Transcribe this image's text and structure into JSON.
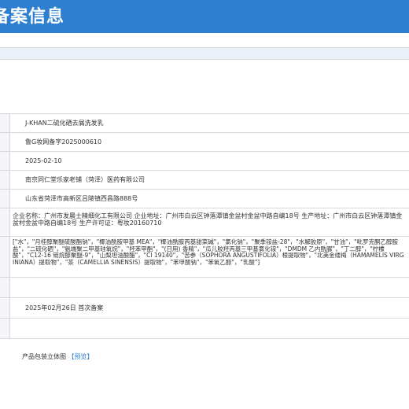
{
  "header": {
    "title": "备案信息"
  },
  "record": {
    "product_name": "J-KHAN二硫化硒去屑洗发乳",
    "record_number": "鲁G妆网备字2025000610",
    "record_date": "2025-02-10",
    "registrant": "南京同仁堂乐家老铺（菏泽）医药有限公司",
    "address": "山东省菏泽市高新区吕陵镇西昌路888号",
    "manufacturer": "企业名称：广州市发晨士精细化工有限公司 企业地址：广州市白云区钟落潭镇金盆村金盆中路自编18号 生产地址：广州市白云区钟落潭镇金盆村金盆中路自编18号 生产许可证：粤妆20160710",
    "ingredients": "[\"水\"，\"月桂醇聚醚硫酸酯钠\"，\"椰油酰胺甲基 MEA\"，\"椰油酰胺丙基甜菜碱\"，\"氯化钠\"，\"聚季铵盐-28\"，\"水解胶原\"，\"甘油\"，\"吡罗克酮乙醇胺盐\"，\"二硫化硒\"，\"氨端聚二甲基硅氧烷\"，\"羟苯甲酯\"，\"(日用) 香精\"，\"瓜儿胶羟丙基三甲基氯化铵\"，\"DMDM 乙内酰脲\"，\"丁二醇\"，\"柠檬酸\"，\"C12-16 链烷醇聚醚-9\"，\"山梨坦油酸酯\"，\"CI 19140\"，\"苦参（SOPHORA ANGUSTIFOLIA）根提取物\"，\"北美金缕梅（HAMAMELIS VIRGINIANA）提取物\"，\"茶（CAMELLIA SINENSIS）提取物\"，\"苯甲酸钠\"，\"苯氧乙醇\"，\"乳酸\"]",
    "status": "2025年02月26日 首次备案"
  },
  "package": {
    "label": "产品包装立体图",
    "preview_link": "预览",
    "bracket_open": "【",
    "bracket_close": "】"
  }
}
